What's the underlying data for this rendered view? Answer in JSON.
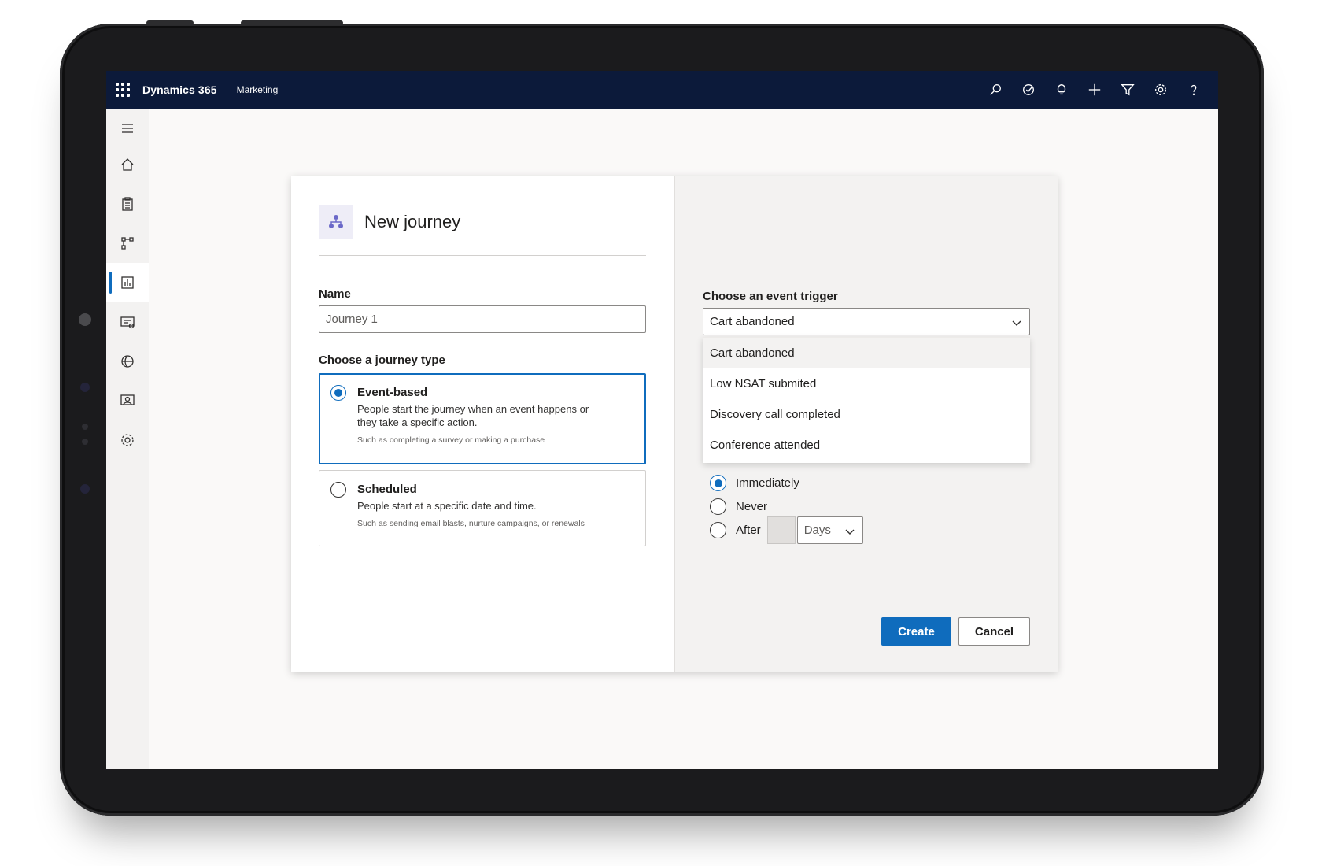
{
  "topbar": {
    "app_name": "Dynamics 365",
    "area_name": "Marketing",
    "icons": [
      "search-icon",
      "task-icon",
      "lightbulb-icon",
      "add-icon",
      "filter-icon",
      "settings-icon",
      "help-icon"
    ]
  },
  "leftnav": {
    "items": [
      "menu-icon",
      "home-icon",
      "clipboard-icon",
      "journey-icon",
      "analytics-icon",
      "email-icon",
      "segments-icon",
      "contacts-icon",
      "settings-icon"
    ],
    "active_index": 4
  },
  "dialog": {
    "title": "New journey",
    "name_label": "Name",
    "name_value": "Journey 1",
    "type_label": "Choose a journey type",
    "options": [
      {
        "title": "Event-based",
        "description": "People start the journey when an event happens or they take a specific action.",
        "hint": "Such as completing a survey or making a purchase",
        "selected": true
      },
      {
        "title": "Scheduled",
        "description": "People start at a specific date and time.",
        "hint": "Such as sending email blasts, nurture campaigns, or renewals",
        "selected": false
      }
    ],
    "trigger_label": "Choose an event trigger",
    "trigger_value": "Cart abandoned",
    "trigger_options": [
      "Cart abandoned",
      "Low NSAT submited",
      "Discovery call completed",
      "Conference attended"
    ],
    "timing_options": [
      "Immediately",
      "Never",
      "After"
    ],
    "timing_selected": "Immediately",
    "after_unit": "Days",
    "create_label": "Create",
    "cancel_label": "Cancel"
  },
  "colors": {
    "accent": "#0f6cbd",
    "topbar": "#0c1a3a"
  }
}
